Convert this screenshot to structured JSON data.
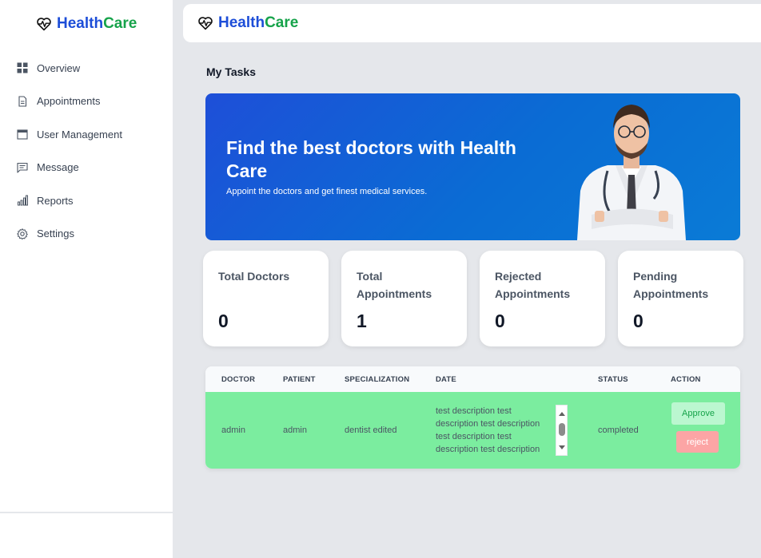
{
  "brand": {
    "part1": "Health",
    "part2": "Care"
  },
  "sidebar": {
    "items": [
      {
        "label": "Overview",
        "icon": "grid-icon"
      },
      {
        "label": "Appointments",
        "icon": "document-icon"
      },
      {
        "label": "User Management",
        "icon": "calendar-icon"
      },
      {
        "label": "Message",
        "icon": "message-icon"
      },
      {
        "label": "Reports",
        "icon": "bar-chart-icon"
      },
      {
        "label": "Settings",
        "icon": "gear-icon"
      }
    ]
  },
  "page": {
    "title": "My Tasks"
  },
  "hero": {
    "title": "Find the best doctors with Health Care",
    "subtitle": "Appoint the doctors and get finest medical services."
  },
  "stats": [
    {
      "label": "Total Doctors",
      "value": "0"
    },
    {
      "label": "Total Appointments",
      "value": "1"
    },
    {
      "label": "Rejected Appointments",
      "value": "0"
    },
    {
      "label": "Pending Appointments",
      "value": "0"
    }
  ],
  "table": {
    "headers": [
      "DOCTOR",
      "PATIENT",
      "SPECIALIZATION",
      "DATE",
      "STATUS",
      "ACTION"
    ],
    "rows": [
      {
        "doctor": "admin",
        "patient": "admin",
        "specialization": "dentist edited",
        "date": "test description test description test description test description test description test description",
        "status": "completed",
        "approve_label": "Approve",
        "reject_label": "reject"
      }
    ]
  },
  "colors": {
    "brand_blue": "#1d4ed8",
    "brand_green": "#16a34a",
    "row_green": "#7bed9f"
  }
}
